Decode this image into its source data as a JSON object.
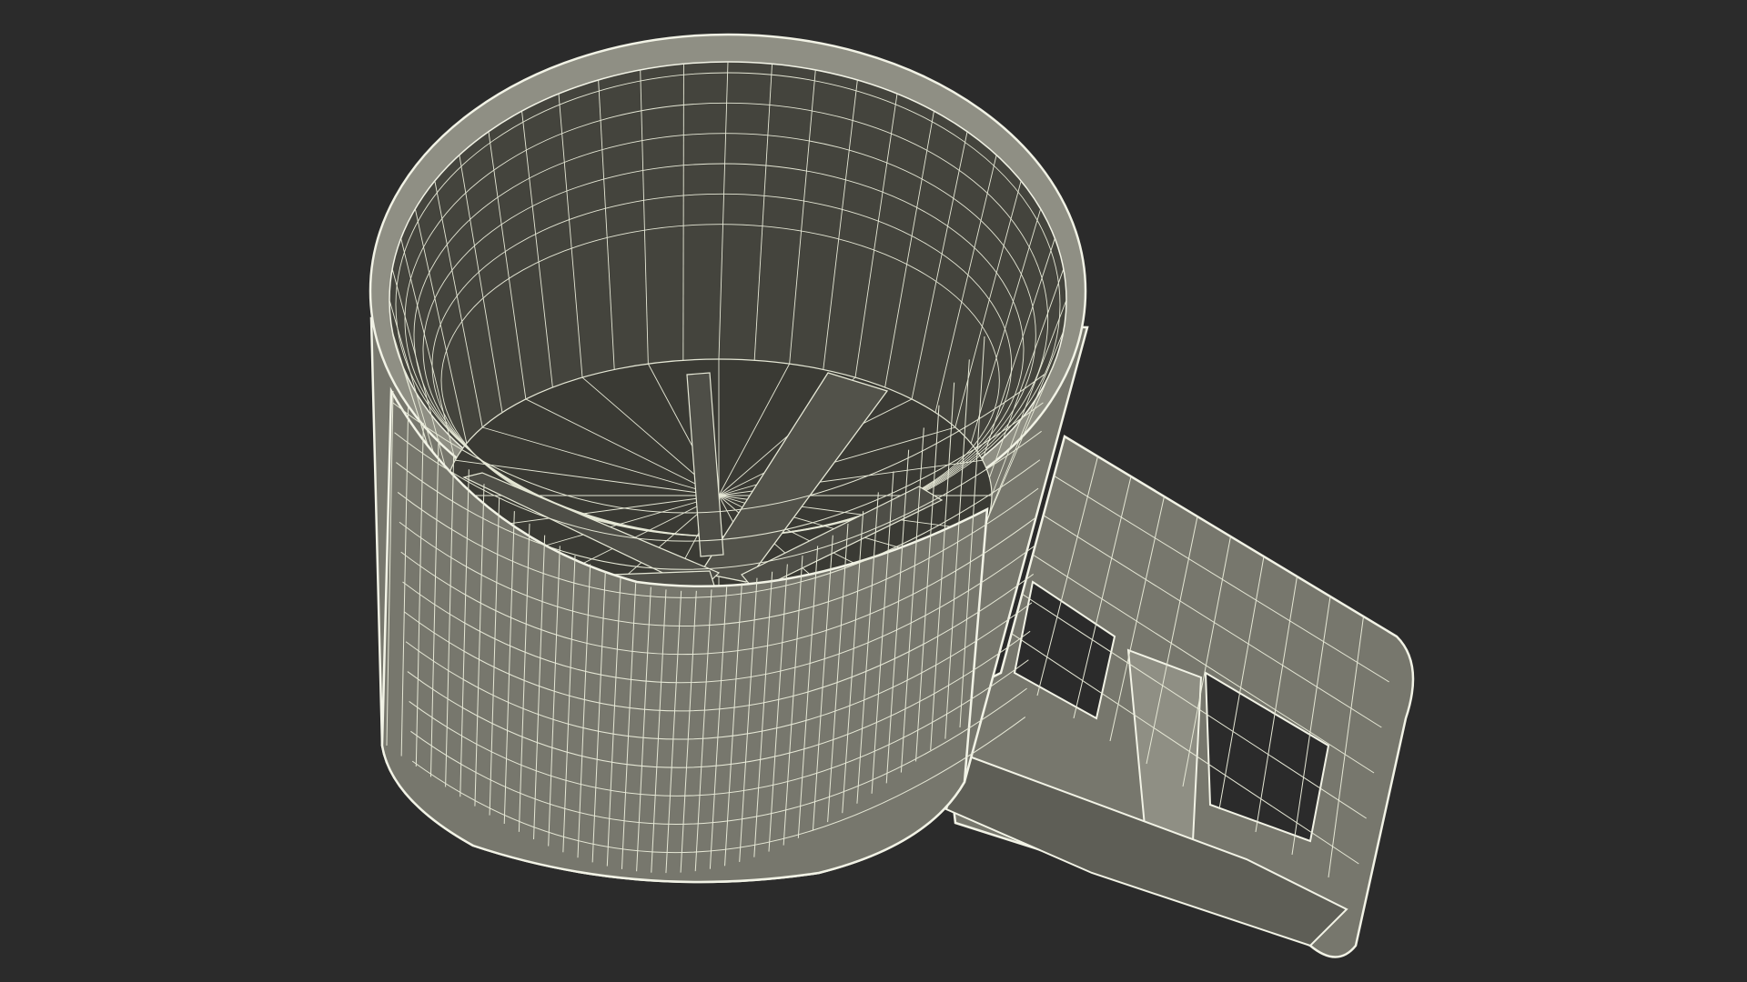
{
  "scene": {
    "subject": "flour-sifter-wireframe-render",
    "colors": {
      "background": "#2b2b2b",
      "surface": "#77776d",
      "surface_light": "#8f8f84",
      "surface_dark": "#4a4a43",
      "interior": "#44443d",
      "interior_deep": "#3a3a34",
      "wire": "#e6e8d6",
      "edge": "#f2f3e6"
    }
  }
}
